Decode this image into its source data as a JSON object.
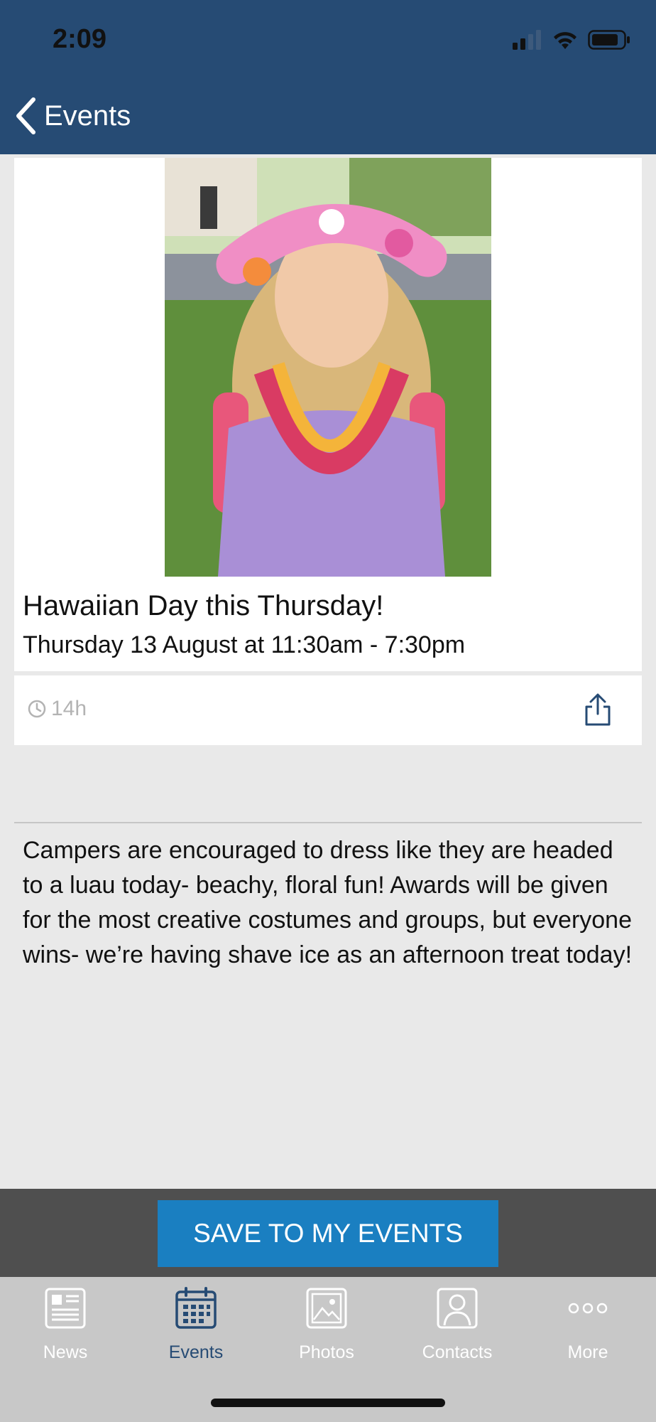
{
  "status_bar": {
    "time": "2:09"
  },
  "nav": {
    "back_label": "Events"
  },
  "event": {
    "title": "Hawaiian Day this Thursday!",
    "datetime": "Thursday 13 August at 11:30am - 7:30pm",
    "posted_ago": "14h",
    "description": "Campers are encouraged to dress like they are headed to a luau today- beachy, floral fun! Awards will be given for the most creative costumes and groups, but everyone wins- we’re having shave ice as an afternoon treat today!"
  },
  "actions": {
    "save_label": "SAVE TO MY EVENTS"
  },
  "tabs": [
    {
      "label": "News",
      "icon": "newspaper-icon",
      "active": false
    },
    {
      "label": "Events",
      "icon": "calendar-icon",
      "active": true
    },
    {
      "label": "Photos",
      "icon": "photo-icon",
      "active": false
    },
    {
      "label": "Contacts",
      "icon": "contact-icon",
      "active": false
    },
    {
      "label": "More",
      "icon": "more-dots-icon",
      "active": false
    }
  ],
  "colors": {
    "header": "#264b74",
    "save_button": "#1a7fc1",
    "save_bar": "#4f4f4f",
    "tab_bar": "#c8c8c8",
    "active_tab": "#264b74"
  }
}
